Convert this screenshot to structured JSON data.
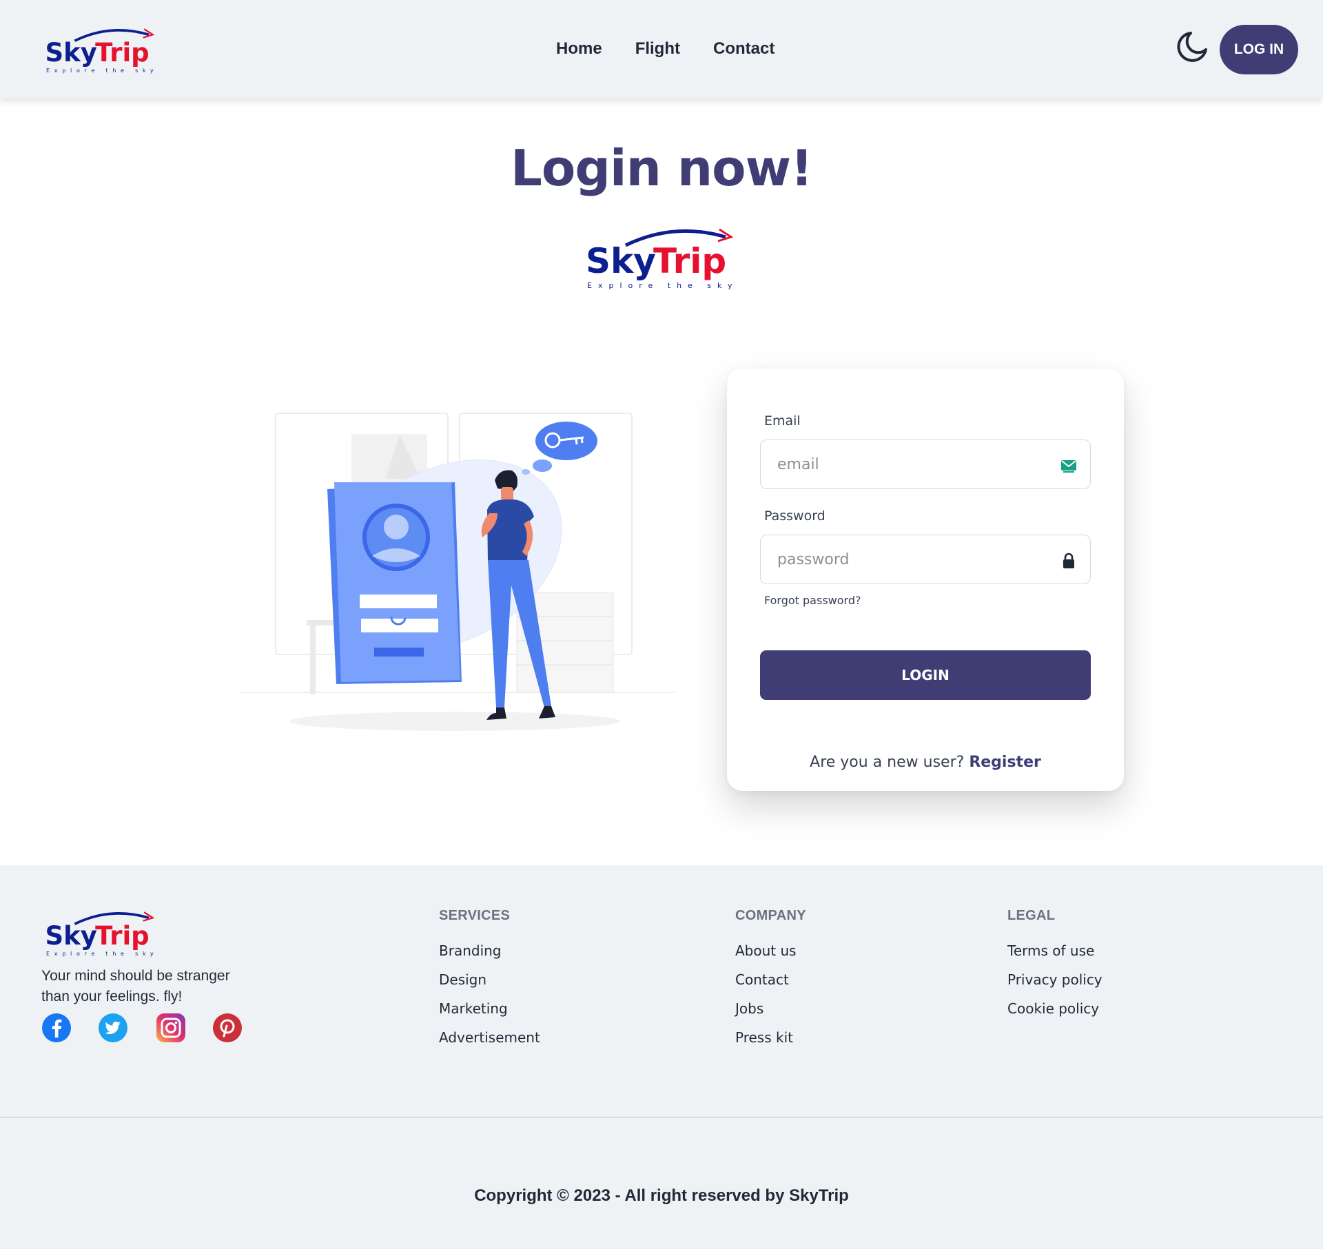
{
  "brand": {
    "name_part1": "Sky",
    "name_part2": "Trip",
    "tagline": "Explore the sky",
    "colors": {
      "sky": "#0b1f8f",
      "trip": "#e5112f",
      "primary": "#3f3d74"
    }
  },
  "navbar": {
    "links": [
      "Home",
      "Flight",
      "Contact"
    ],
    "theme_toggle_icon": "moon-icon",
    "login_label": "LOG IN"
  },
  "main": {
    "title": "Login now!"
  },
  "login_form": {
    "email_label": "Email",
    "email_placeholder": "email",
    "email_icon": "mail-icon",
    "password_label": "Password",
    "password_placeholder": "password",
    "password_icon": "lock-icon",
    "forgot_password": "Forgot password?",
    "submit_label": "LOGIN",
    "register_prompt": "Are you a new user?",
    "register_link": "Register"
  },
  "footer": {
    "tagline": "Your mind should be stranger than your feelings. fly!",
    "social": [
      "facebook-icon",
      "twitter-icon",
      "instagram-icon",
      "pinterest-icon"
    ],
    "columns": [
      {
        "title": "SERVICES",
        "links": [
          "Branding",
          "Design",
          "Marketing",
          "Advertisement"
        ]
      },
      {
        "title": "COMPANY",
        "links": [
          "About us",
          "Contact",
          "Jobs",
          "Press kit"
        ]
      },
      {
        "title": "LEGAL",
        "links": [
          "Terms of use",
          "Privacy policy",
          "Cookie policy"
        ]
      }
    ],
    "copyright": "Copyright © 2023 - All right reserved by SkyTrip"
  }
}
